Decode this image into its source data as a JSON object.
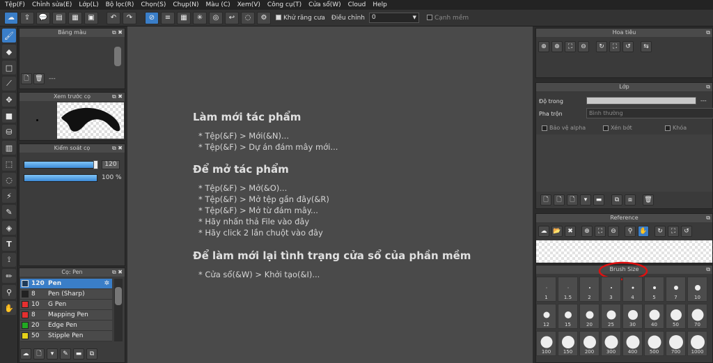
{
  "menu": [
    "Tệp(F)",
    "Chỉnh sửa(E)",
    "Lớp(L)",
    "Bộ lọc(R)",
    "Chọn(S)",
    "Chụp(N)",
    "Màu (C)",
    "Xem(V)",
    "Công cụ(T)",
    "Cửa sổ(W)",
    "Cloud",
    "Help"
  ],
  "toolbar": {
    "antialias_label": "Khử răng cưa",
    "adjust_label": "Điều chỉnh",
    "adjust_value": "0",
    "edge_label": "Cạnh mềm"
  },
  "panels": {
    "palette_title": "Bảng màu",
    "palette_placeholder": "---",
    "preview_title": "Xem trước cọ",
    "brush_control_title": "Kiểm soát cọ",
    "brush_size_value": "120",
    "brush_opacity_value": "100 %",
    "brush_list_title": "Cọ: Pen",
    "navigator_title": "Hoa tiêu",
    "layer_title": "Lớp",
    "opacity_label": "Độ trong",
    "opacity_value": "---",
    "blend_label": "Pha trộn",
    "blend_value": "Bình thường",
    "protect_alpha": "Bảo vệ alpha",
    "clipping": "Xén bớt",
    "lock": "Khóa",
    "reference_title": "Reference",
    "brush_size_title": "Brush Size"
  },
  "pens": [
    {
      "size": "120",
      "name": "Pen",
      "color": "#1f3b5a"
    },
    {
      "size": "8",
      "name": "Pen (Sharp)",
      "color": "#222222"
    },
    {
      "size": "10",
      "name": "G Pen",
      "color": "#e53030"
    },
    {
      "size": "8",
      "name": "Mapping Pen",
      "color": "#e53030"
    },
    {
      "size": "20",
      "name": "Edge Pen",
      "color": "#22aa22"
    },
    {
      "size": "50",
      "name": "Stipple Pen",
      "color": "#e6d21a"
    }
  ],
  "brush_sizes": [
    "1",
    "1.5",
    "2",
    "3",
    "4",
    "5",
    "7",
    "10",
    "12",
    "15",
    "20",
    "25",
    "30",
    "40",
    "50",
    "70",
    "100",
    "150",
    "200",
    "300",
    "400",
    "500",
    "700",
    "1000"
  ],
  "welcome": {
    "new_heading": "Làm mới tác phẩm",
    "new_items": [
      "* Tệp(&F) > Mới(&N)...",
      "* Tệp(&F) > Dự án đám mây mới..."
    ],
    "open_heading": "Để mở tác phẩm",
    "open_items": [
      "* Tệp(&F) > Mở(&O)...",
      "* Tệp(&F) > Mở tệp gần đây(&R)",
      "* Tệp(&F) > Mở từ đám mây...",
      "* Hãy nhấn thả File vào đây",
      "* Hãy click 2 lần chuột vào đây"
    ],
    "reset_heading": "Để làm mới lại tình trạng cửa sổ của phần mềm",
    "reset_items": [
      "* Cửa sổ(&W) > Khởi tạo(&I)..."
    ]
  },
  "colors": {
    "accent": "#3a7ec8",
    "annotation": "#e01010"
  }
}
